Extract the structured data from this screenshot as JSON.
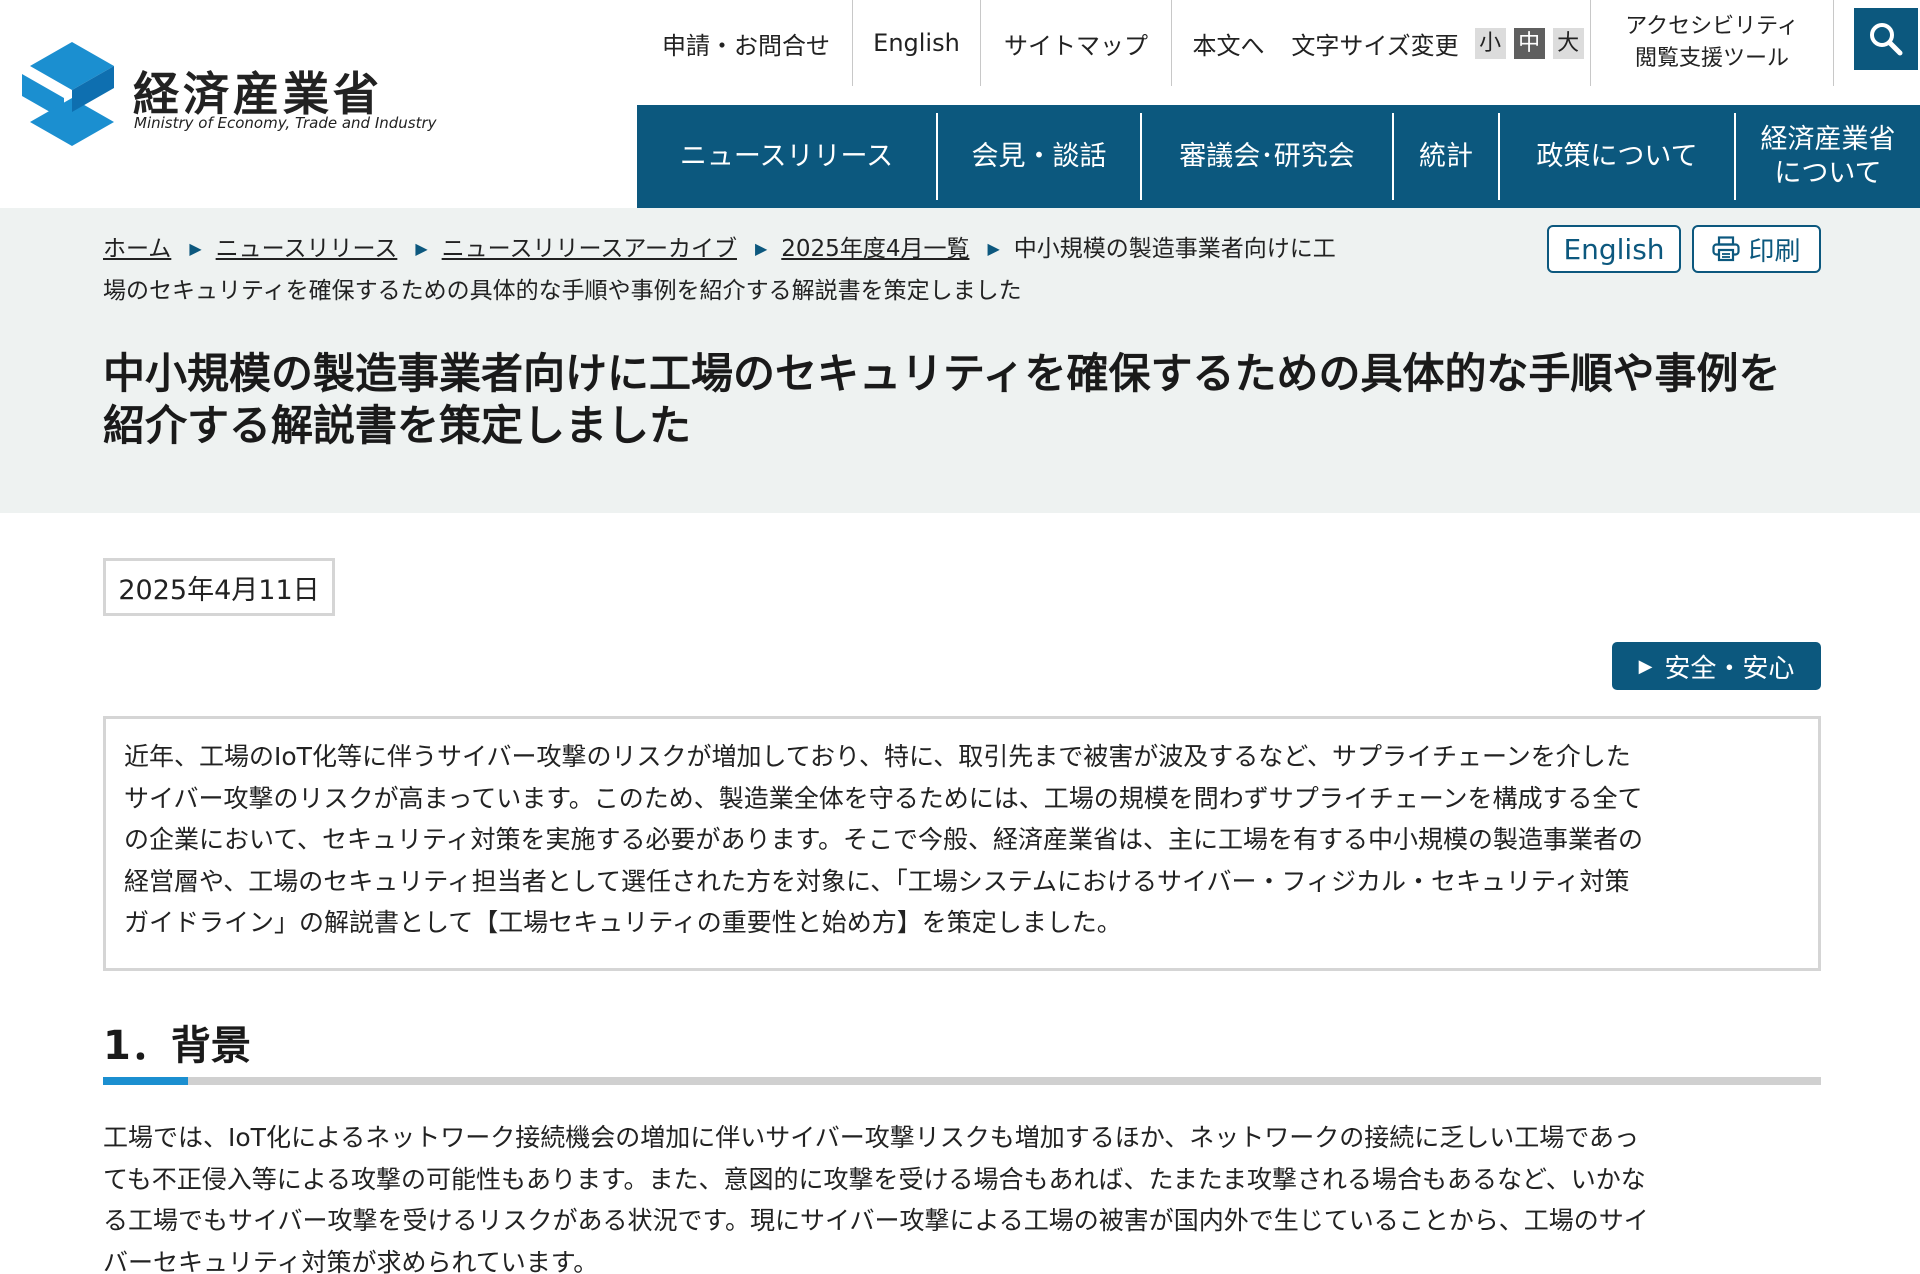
{
  "header": {
    "logo": {
      "name": "経済産業省",
      "sub": "Ministry of Economy, Trade and Industry",
      "icon": "meti-logo-icon"
    },
    "utility": {
      "contact": "申請・お問合せ",
      "english": "English",
      "sitemap": "サイトマップ",
      "main_text": "本文へ",
      "font_size_label": "文字サイズ変更",
      "font_small": "小",
      "font_medium": "中",
      "font_large": "大",
      "accessibility_line1": "アクセシビリティ",
      "accessibility_line2": "閲覧支援ツール",
      "search_icon": "search-icon"
    },
    "gnav": [
      {
        "label": "ニュースリリース"
      },
      {
        "label": "会見・談話"
      },
      {
        "label": "審議会･研究会"
      },
      {
        "label": "統計"
      },
      {
        "label": "政策について"
      },
      {
        "label_line1": "経済産業省",
        "label_line2": "について"
      }
    ]
  },
  "breadcrumb": {
    "items": [
      "ホーム",
      "ニュースリリース",
      "ニュースリリースアーカイブ",
      "2025年度4月一覧"
    ],
    "current_line1": "中小規模の製造事業者向けに工",
    "current_line2": "場のセキュリティを確保するための具体的な手順や事例を紹介する解説書を策定しました"
  },
  "actions": {
    "english": "English",
    "print": "印刷",
    "print_icon": "printer-icon"
  },
  "title_line1": "中小規模の製造事業者向けに工場のセキュリティを確保するための具体的な手順や事例を",
  "title_line2": "紹介する解説書を策定しました",
  "date": "2025年4月11日",
  "tag": "安全・安心",
  "lead_lines": [
    "近年、工場のIoT化等に伴うサイバー攻撃のリスクが増加しており、特に、取引先まで被害が波及するなど、サプライチェーンを介した",
    "サイバー攻撃のリスクが高まっています。このため、製造業全体を守るためには、工場の規模を問わずサプライチェーンを構成する全て",
    "の企業において、セキュリティ対策を実施する必要があります。そこで今般、経済産業省は、主に工場を有する中小規模の製造事業者の",
    "経営層や、工場のセキュリティ担当者として選任された方を対象に、「工場システムにおけるサイバー・フィジカル・セキュリティ対策",
    "ガイドライン」の解説書として【工場セキュリティの重要性と始め方】を策定しました。"
  ],
  "section1": {
    "heading": "1．背景",
    "lines": [
      "工場では、IoT化によるネットワーク接続機会の増加に伴いサイバー攻撃リスクも増加するほか、ネットワークの接続に乏しい工場であっ",
      "ても不正侵入等による攻撃の可能性もあります。また、意図的に攻撃を受ける場合もあれば、たまたま攻撃される場合もあるなど、いかな",
      "る工場でもサイバー攻撃を受けるリスクがある状況です。現にサイバー攻撃による工場の被害が国内外で生じていることから、工場のサイ",
      "バーセキュリティ対策が求められています。"
    ]
  },
  "colors": {
    "brand_navy": "#0c587e",
    "accent_blue": "#1b8fd0",
    "band_bg": "#eef2f1"
  }
}
